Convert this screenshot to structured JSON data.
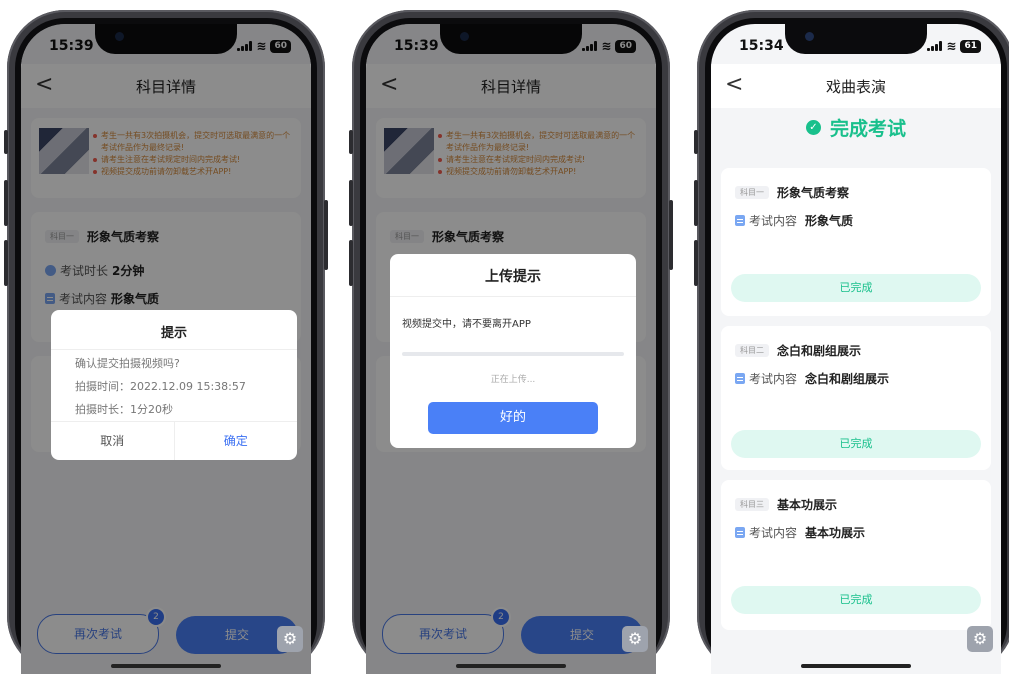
{
  "phone1": {
    "status": {
      "time": "15:39",
      "battery": "60"
    },
    "nav": {
      "back": "<",
      "title": "科目详情"
    },
    "notes": [
      "考生一共有3次拍摄机会，提交时可选取最满意的一个考试作品作为最终记录!",
      "请考生注意在考试规定时间内完成考试!",
      "视频提交成功前请勿卸载艺术开APP!"
    ],
    "subject": {
      "tag": "科目一",
      "name": "形象气质考察",
      "duration_label": "考试时长",
      "duration": "2分钟",
      "content_label": "考试内容",
      "content": "形象气质"
    },
    "dialog": {
      "title": "提示",
      "question": "确认提交拍摄视频吗?",
      "time_line": "拍摄时间：2022.12.09 15:38:57",
      "length_line": "拍摄时长：1分20秒",
      "cancel": "取消",
      "confirm": "确定"
    },
    "bottom": {
      "retry": "再次考试",
      "badge": "2",
      "submit": "提交"
    }
  },
  "phone2": {
    "status": {
      "time": "15:39",
      "battery": "60"
    },
    "nav": {
      "back": "<",
      "title": "科目详情"
    },
    "notes": [
      "考生一共有3次拍摄机会，提交时可选取最满意的一个考试作品作为最终记录!",
      "请考生注意在考试规定时间内完成考试!",
      "视频提交成功前请勿卸载艺术开APP!"
    ],
    "subject": {
      "tag": "科目一",
      "name": "形象气质考察"
    },
    "dialog": {
      "title": "上传提示",
      "message": "视频提交中，请不要离开APP",
      "progress_text": "正在上传...",
      "progress": 0,
      "ok": "好的"
    },
    "bottom": {
      "retry": "再次考试",
      "badge": "2",
      "submit": "提交"
    }
  },
  "phone3": {
    "status": {
      "time": "15:34",
      "battery": "61"
    },
    "nav": {
      "back": "<",
      "title": "戏曲表演"
    },
    "header": "完成考试",
    "subjects": [
      {
        "tag": "科目一",
        "name": "形象气质考察",
        "content_label": "考试内容",
        "content": "形象气质",
        "status": "已完成"
      },
      {
        "tag": "科目二",
        "name": "念白和剧组展示",
        "content_label": "考试内容",
        "content": "念白和剧组展示",
        "status": "已完成"
      },
      {
        "tag": "科目三",
        "name": "基本功展示",
        "content_label": "考试内容",
        "content": "基本功展示",
        "status": "已完成"
      }
    ]
  },
  "colors": {
    "accent": "#4a80f7",
    "success": "#19c08c",
    "warning": "#d58a3b"
  }
}
